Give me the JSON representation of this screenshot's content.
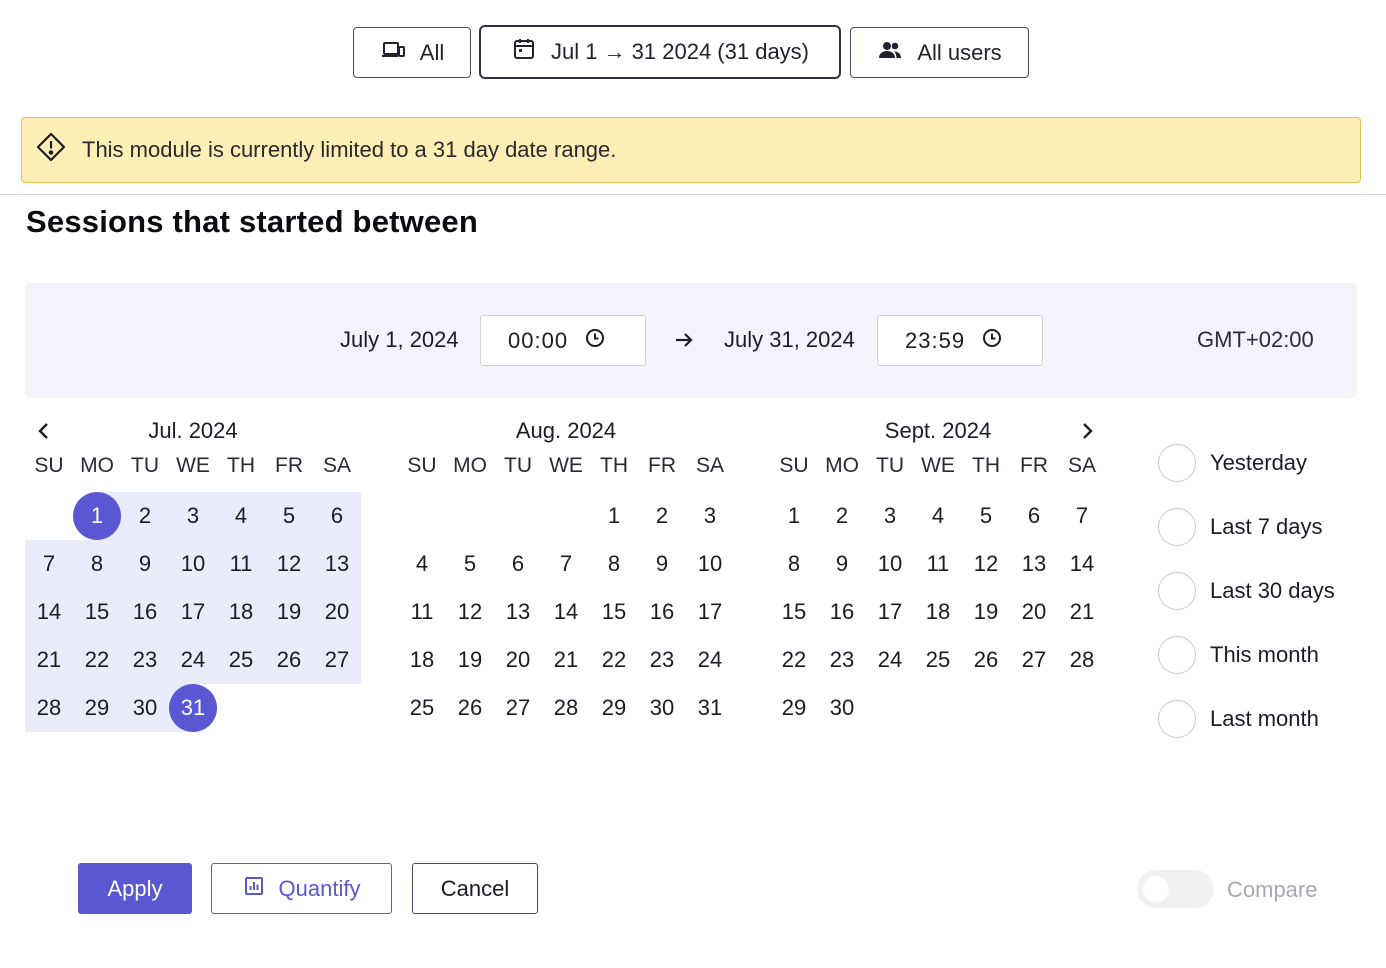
{
  "filters": {
    "device": {
      "label": "All",
      "icon": "devices-icon"
    },
    "date": {
      "label": "Jul 1 → 31 2024 (31 days)",
      "icon": "calendar-icon"
    },
    "users": {
      "label": "All users",
      "icon": "users-icon"
    }
  },
  "banner": {
    "text": "This module is currently limited to a 31 day date range.",
    "icon": "warning-diamond-icon"
  },
  "section_title": "Sessions that started between",
  "range": {
    "start_date": "July 1, 2024",
    "start_time": "00:00",
    "end_date": "July 31, 2024",
    "end_time": "23:59",
    "timezone": "GMT+02:00"
  },
  "weekdays": [
    "SU",
    "MO",
    "TU",
    "WE",
    "TH",
    "FR",
    "SA"
  ],
  "calendars": [
    {
      "title": "Jul. 2024",
      "offset": 1,
      "days": 31,
      "range_start": 1,
      "range_end": 31
    },
    {
      "title": "Aug. 2024",
      "offset": 4,
      "days": 31,
      "range_start": null,
      "range_end": null
    },
    {
      "title": "Sept. 2024",
      "offset": 0,
      "days": 30,
      "range_start": null,
      "range_end": null
    }
  ],
  "presets": [
    {
      "label": "Yesterday",
      "selected": false
    },
    {
      "label": "Last 7 days",
      "selected": false
    },
    {
      "label": "Last 30 days",
      "selected": false
    },
    {
      "label": "This month",
      "selected": false
    },
    {
      "label": "Last month",
      "selected": false
    }
  ],
  "actions": {
    "apply": "Apply",
    "quantify": "Quantify",
    "cancel": "Cancel"
  },
  "compare": {
    "label": "Compare",
    "enabled": false
  },
  "colors": {
    "accent": "#5a57d3",
    "range_fill": "#eaecfb",
    "banner_bg": "#fdefb5"
  }
}
